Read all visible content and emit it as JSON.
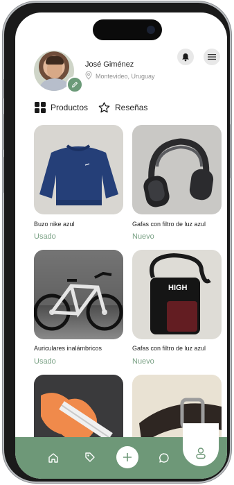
{
  "profile": {
    "name": "José Giménez",
    "location": "Montevideo, Uruguay"
  },
  "tabs": [
    {
      "label": "Productos",
      "icon": "grid-icon",
      "active": true
    },
    {
      "label": "Reseñas",
      "icon": "star-icon",
      "active": false
    }
  ],
  "header_actions": [
    "bell-icon",
    "menu-icon"
  ],
  "products": [
    {
      "name": "Buzo nike azul",
      "condition": "Usado",
      "image": "blue-sweater"
    },
    {
      "name": "Gafas con filtro de luz azul",
      "condition": "Nuevo",
      "image": "headphones"
    },
    {
      "name": "Auriculares inalámbricos",
      "condition": "Usado",
      "image": "bicycle"
    },
    {
      "name": "Gafas con filtro de luz azul",
      "condition": "Nuevo",
      "image": "crossbody-bag"
    },
    {
      "name": "",
      "condition": "",
      "image": "electric-guitar"
    },
    {
      "name": "",
      "condition": "",
      "image": "leather-belt"
    }
  ],
  "navbar": {
    "items": [
      "home-icon",
      "tag-icon",
      "add-icon",
      "chat-icon",
      "profile-icon"
    ],
    "active": "profile-icon"
  },
  "colors": {
    "accent": "#6e9878",
    "condition_text": "#7aa185"
  }
}
